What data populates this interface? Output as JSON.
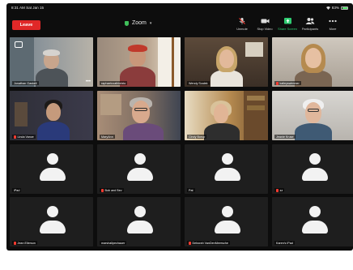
{
  "status": {
    "time": "8:31 AM  Sat Jan 15",
    "battery": "83%"
  },
  "toolbar": {
    "leave_label": "Leave",
    "title": "Zoom",
    "tools": [
      {
        "label": "Unmute",
        "icon": "microphone-muted-icon"
      },
      {
        "label": "Stop Video",
        "icon": "video-camera-icon"
      },
      {
        "label": "Share Screen",
        "icon": "share-screen-icon"
      },
      {
        "label": "Participants",
        "icon": "participants-icon"
      },
      {
        "label": "More",
        "icon": "more-icon"
      }
    ]
  },
  "participants": [
    {
      "name": "Jonathan Gaskell",
      "muted": false,
      "video": true
    },
    {
      "name": "raphaelcoathbrixto",
      "muted": false,
      "video": true
    },
    {
      "name": "Wendy Scalek",
      "muted": false,
      "video": true
    },
    {
      "name": "kalleyswimmer",
      "muted": true,
      "video": true
    },
    {
      "name": "Linda Vance",
      "muted": true,
      "video": true
    },
    {
      "name": "MaryAnn",
      "muted": false,
      "video": true
    },
    {
      "name": "Cindy Borup",
      "muted": false,
      "video": true
    },
    {
      "name": "Jeanie Kruse",
      "muted": false,
      "video": true
    },
    {
      "name": "iPad",
      "muted": false,
      "video": false
    },
    {
      "name": "Bob and Bev",
      "muted": true,
      "video": false
    },
    {
      "name": "Pat",
      "muted": false,
      "video": false
    },
    {
      "name": "zz",
      "muted": true,
      "video": false
    },
    {
      "name": "Jean Ellerson",
      "muted": true,
      "video": false
    },
    {
      "name": "marshallpechauer",
      "muted": false,
      "video": false
    },
    {
      "name": "Deborah VanDenMeersche",
      "muted": true,
      "video": false
    },
    {
      "name": "Karen's iPad",
      "muted": false,
      "video": false
    }
  ],
  "colors": {
    "leave": "#e02828",
    "share_active": "#2ecc71",
    "muted": "#ff3b30",
    "background": "#0d0d0d"
  }
}
